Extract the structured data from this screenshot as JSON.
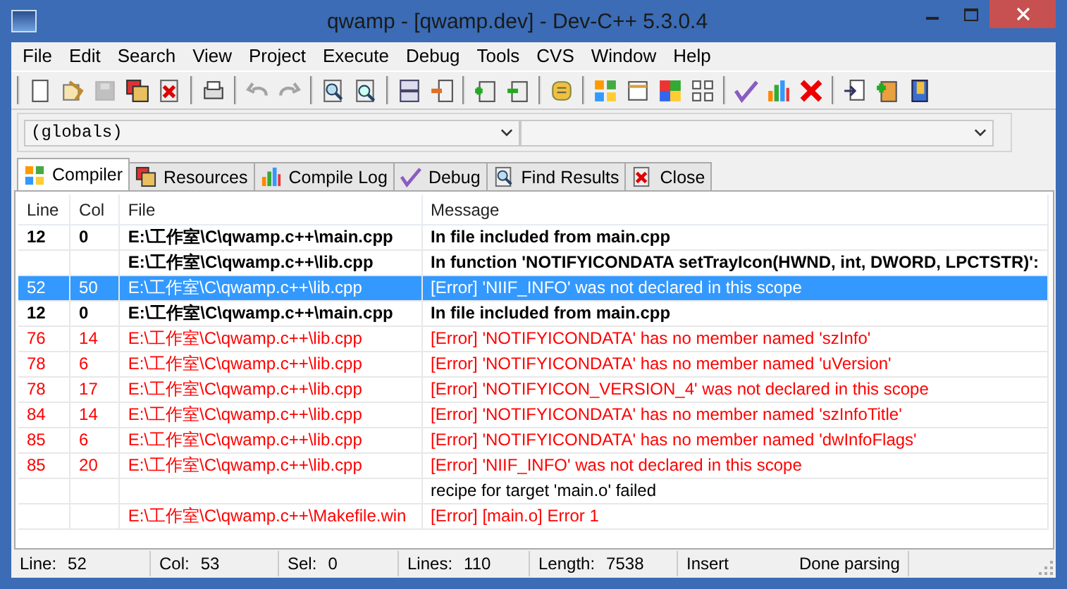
{
  "window": {
    "title": "qwamp - [qwamp.dev] - Dev-C++ 5.3.0.4"
  },
  "menu": [
    "File",
    "Edit",
    "Search",
    "View",
    "Project",
    "Execute",
    "Debug",
    "Tools",
    "CVS",
    "Window",
    "Help"
  ],
  "toolbar": [
    [
      {
        "kind": "new",
        "disabled": false
      },
      {
        "kind": "open",
        "disabled": false
      },
      {
        "kind": "save",
        "disabled": true
      },
      {
        "kind": "saveall",
        "disabled": false
      },
      {
        "kind": "closefile",
        "disabled": false
      }
    ],
    [
      {
        "kind": "print",
        "disabled": false
      }
    ],
    [
      {
        "kind": "undo",
        "disabled": true
      },
      {
        "kind": "redo",
        "disabled": true
      }
    ],
    [
      {
        "kind": "find",
        "disabled": false
      },
      {
        "kind": "replace",
        "disabled": false
      }
    ],
    [
      {
        "kind": "split",
        "disabled": false
      },
      {
        "kind": "split2",
        "disabled": false
      }
    ],
    [
      {
        "kind": "add",
        "disabled": false
      },
      {
        "kind": "remove",
        "disabled": false
      }
    ],
    [
      {
        "kind": "options",
        "disabled": false
      }
    ],
    [
      {
        "kind": "grid",
        "disabled": false
      },
      {
        "kind": "window",
        "disabled": false
      },
      {
        "kind": "grid2",
        "disabled": false
      },
      {
        "kind": "grid3",
        "disabled": false
      }
    ],
    [
      {
        "kind": "check",
        "disabled": false
      },
      {
        "kind": "chart",
        "disabled": false
      },
      {
        "kind": "stop",
        "disabled": false
      }
    ],
    [
      {
        "kind": "goto",
        "disabled": false
      },
      {
        "kind": "addfile",
        "disabled": false
      },
      {
        "kind": "book",
        "disabled": false
      }
    ]
  ],
  "class_combo": {
    "value": "(globals)"
  },
  "tabs": [
    {
      "label": "Compiler",
      "selected": true
    },
    {
      "label": "Resources",
      "selected": false
    },
    {
      "label": "Compile Log",
      "selected": false
    },
    {
      "label": "Debug",
      "selected": false
    },
    {
      "label": "Find Results",
      "selected": false
    },
    {
      "label": "Close",
      "selected": false
    }
  ],
  "table": {
    "columns": [
      "Line",
      "Col",
      "File",
      "Message"
    ],
    "rows": [
      {
        "kind": "bold",
        "selected": false,
        "cells": [
          "12",
          "0",
          "E:\\工作室\\C\\qwamp.c++\\main.cpp",
          "In file included from main.cpp"
        ]
      },
      {
        "kind": "bold",
        "selected": false,
        "cells": [
          "",
          "",
          "E:\\工作室\\C\\qwamp.c++\\lib.cpp",
          "In function 'NOTIFYICONDATA setTrayIcon(HWND, int, DWORD, LPCTSTR)':"
        ]
      },
      {
        "kind": "error",
        "selected": true,
        "cells": [
          "52",
          "50",
          "E:\\工作室\\C\\qwamp.c++\\lib.cpp",
          "[Error] 'NIIF_INFO' was not declared in this scope"
        ]
      },
      {
        "kind": "bold",
        "selected": false,
        "cells": [
          "12",
          "0",
          "E:\\工作室\\C\\qwamp.c++\\main.cpp",
          "In file included from main.cpp"
        ]
      },
      {
        "kind": "error",
        "selected": false,
        "cells": [
          "76",
          "14",
          "E:\\工作室\\C\\qwamp.c++\\lib.cpp",
          "[Error] 'NOTIFYICONDATA' has no member named 'szInfo'"
        ]
      },
      {
        "kind": "error",
        "selected": false,
        "cells": [
          "78",
          "6",
          "E:\\工作室\\C\\qwamp.c++\\lib.cpp",
          "[Error] 'NOTIFYICONDATA' has no member named 'uVersion'"
        ]
      },
      {
        "kind": "error",
        "selected": false,
        "cells": [
          "78",
          "17",
          "E:\\工作室\\C\\qwamp.c++\\lib.cpp",
          "[Error] 'NOTIFYICON_VERSION_4' was not declared in this scope"
        ]
      },
      {
        "kind": "error",
        "selected": false,
        "cells": [
          "84",
          "14",
          "E:\\工作室\\C\\qwamp.c++\\lib.cpp",
          "[Error] 'NOTIFYICONDATA' has no member named 'szInfoTitle'"
        ]
      },
      {
        "kind": "error",
        "selected": false,
        "cells": [
          "85",
          "6",
          "E:\\工作室\\C\\qwamp.c++\\lib.cpp",
          "[Error] 'NOTIFYICONDATA' has no member named 'dwInfoFlags'"
        ]
      },
      {
        "kind": "error",
        "selected": false,
        "cells": [
          "85",
          "20",
          "E:\\工作室\\C\\qwamp.c++\\lib.cpp",
          "[Error] 'NIIF_INFO' was not declared in this scope"
        ]
      },
      {
        "kind": "plain",
        "selected": false,
        "cells": [
          "",
          "",
          "",
          "recipe for target 'main.o' failed"
        ]
      },
      {
        "kind": "error",
        "selected": false,
        "cells": [
          "",
          "",
          "E:\\工作室\\C\\qwamp.c++\\Makefile.win",
          "[Error] [main.o] Error 1"
        ]
      }
    ]
  },
  "status_bar": [
    {
      "label": "Line:",
      "value": "52"
    },
    {
      "label": "Col:",
      "value": "53"
    },
    {
      "label": "Sel:",
      "value": "0"
    },
    {
      "label": "Lines:",
      "value": "110"
    },
    {
      "label": "Length:",
      "value": "7538"
    },
    {
      "value": "Insert"
    },
    {
      "value": "Done parsing"
    }
  ]
}
